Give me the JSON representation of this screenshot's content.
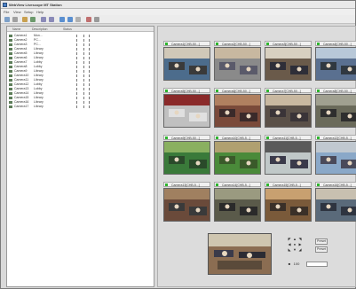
{
  "window": {
    "title": "WebView Livescope MT Station"
  },
  "menu": [
    "File",
    "View",
    "Setup",
    "Help"
  ],
  "list": {
    "headers": [
      "Name",
      "Description",
      "Status"
    ],
    "rows": [
      {
        "name": "Camera1",
        "desc": "Mon..."
      },
      {
        "name": "Camera2",
        "desc": "PC..."
      },
      {
        "name": "Camera3",
        "desc": "PC..."
      },
      {
        "name": "Camera4",
        "desc": "Library"
      },
      {
        "name": "Camera5",
        "desc": "Library"
      },
      {
        "name": "Camera6",
        "desc": "Library"
      },
      {
        "name": "Camera7",
        "desc": "Lobby"
      },
      {
        "name": "Camera8",
        "desc": "Lobby"
      },
      {
        "name": "Camera9",
        "desc": "Library"
      },
      {
        "name": "Camera10",
        "desc": "Library"
      },
      {
        "name": "Camera11",
        "desc": "Library"
      },
      {
        "name": "Camera12",
        "desc": "Lobby"
      },
      {
        "name": "Camera13",
        "desc": "Lobby"
      },
      {
        "name": "Camera14",
        "desc": "Library"
      },
      {
        "name": "Camera15",
        "desc": "Library"
      },
      {
        "name": "Camera16",
        "desc": "Library"
      },
      {
        "name": "Camera17",
        "desc": "Library"
      }
    ]
  },
  "tiles": [
    "Camera1[CHB-50...]",
    "Camera2[CHB-50...]",
    "Camera3[CHB-50...]",
    "Camera4[CHB-50...]",
    "Camera5[CHB-50...]",
    "Camera6[CHB-50...]",
    "Camera7[CHB-50...]",
    "Camera8[CHB-50...]",
    "Camera9[CHB-50...]",
    "Camera10[CHB-5...]",
    "Camera11[CHB-5...]",
    "Camera12[CHB-5...]",
    "Camera13[CHB-5...]",
    "Camera14[CHB-5...]",
    "Camera15[CHB-5...]",
    "Camera16[CHB-5...]"
  ],
  "ptz": {
    "btn1": "Preset",
    "btn2": "Preset",
    "zoom": "100"
  }
}
